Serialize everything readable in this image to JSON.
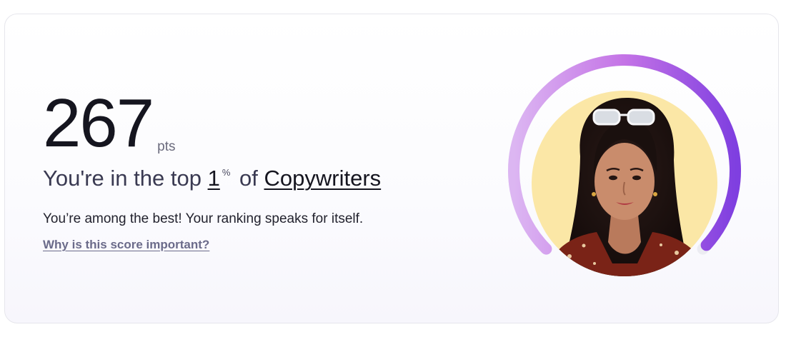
{
  "score": {
    "value": "267",
    "unit": "pts"
  },
  "rank": {
    "prefix": "You're in the top",
    "percent": "1",
    "percent_symbol": "%",
    "connector": "of",
    "category": "Copywriters"
  },
  "subtitle": "You’re among the best! Your ranking speaks for itself.",
  "link": {
    "label": "Why is this score important?"
  },
  "gauge": {
    "progress": 0.99,
    "gradient_start": "#dcb6f2",
    "gradient_mid": "#c473e6",
    "gradient_end": "#7f3fe0",
    "track_color": "#ececf2",
    "avatar_bg": "#fbe7a6"
  }
}
